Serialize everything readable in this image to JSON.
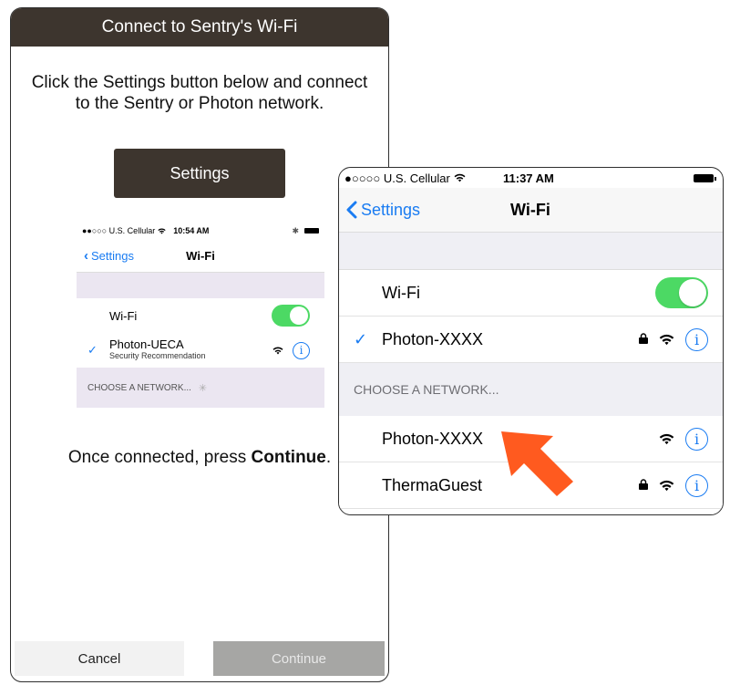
{
  "app": {
    "title": "Connect to Sentry's Wi-Fi",
    "instructions": "Click the Settings button below and connect to the Sentry or Photon network.",
    "settings_button": "Settings",
    "once_connected_prefix": "Once connected, press ",
    "once_connected_bold": "Continue",
    "once_connected_suffix": ".",
    "cancel_button": "Cancel",
    "continue_button": "Continue"
  },
  "mini_screen": {
    "carrier": "●●○○○ U.S. Cellular",
    "time": "10:54 AM",
    "back_label": "Settings",
    "nav_title": "Wi-Fi",
    "wifi_label": "Wi-Fi",
    "connected_network": "Photon-UECA",
    "connected_subtitle": "Security Recommendation",
    "choose_network": "CHOOSE A NETWORK..."
  },
  "zoom_screen": {
    "carrier": "●○○○○ U.S. Cellular",
    "time": "11:37 AM",
    "back_label": "Settings",
    "nav_title": "Wi-Fi",
    "wifi_label": "Wi-Fi",
    "connected_network": "Photon-XXXX",
    "choose_network": "CHOOSE A NETWORK...",
    "networks": [
      {
        "name": "Photon-XXXX"
      },
      {
        "name": "ThermaGuest"
      }
    ]
  },
  "colors": {
    "title_bar": "#3d352e",
    "ios_blue": "#1a7cf2",
    "toggle_on": "#4cd964",
    "arrow": "#ff5a1f",
    "continue_disabled": "#a6a6a4"
  },
  "icons": [
    "chevron-left-icon",
    "checkmark-icon",
    "wifi-icon",
    "lock-icon",
    "info-icon",
    "bluetooth-icon",
    "battery-icon",
    "spinner-icon",
    "arrow-pointer-icon"
  ]
}
